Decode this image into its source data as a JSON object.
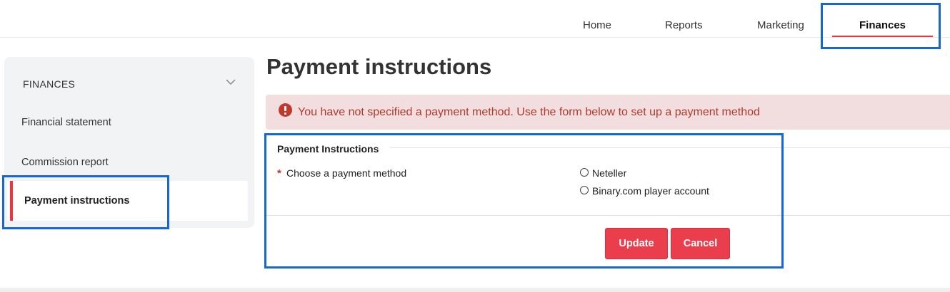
{
  "topnav": {
    "items": [
      "Home",
      "Reports",
      "Marketing",
      "Finances"
    ],
    "active": "Finances",
    "accent_color": "#e9363f"
  },
  "sidebar": {
    "header": "FINANCES",
    "header_icon": "chevron-down-icon",
    "items": [
      "Financial statement",
      "Commission report",
      "Payment instructions"
    ],
    "active": "Payment instructions"
  },
  "main": {
    "title": "Payment instructions",
    "alert": {
      "icon": "error-circle-icon",
      "text": "You have not specified a payment method. Use the form below to set up a payment method",
      "color": "#b03a2e",
      "background": "#f2dede"
    },
    "form": {
      "legend": "Payment Instructions",
      "required_mark": "*",
      "field_label": "Choose a payment method",
      "options": [
        "Neteller",
        "Binary.com player account"
      ],
      "buttons": {
        "update": "Update",
        "cancel": "Cancel"
      },
      "button_color": "#ea3e4d"
    }
  },
  "annotation_color": "#1466d9"
}
